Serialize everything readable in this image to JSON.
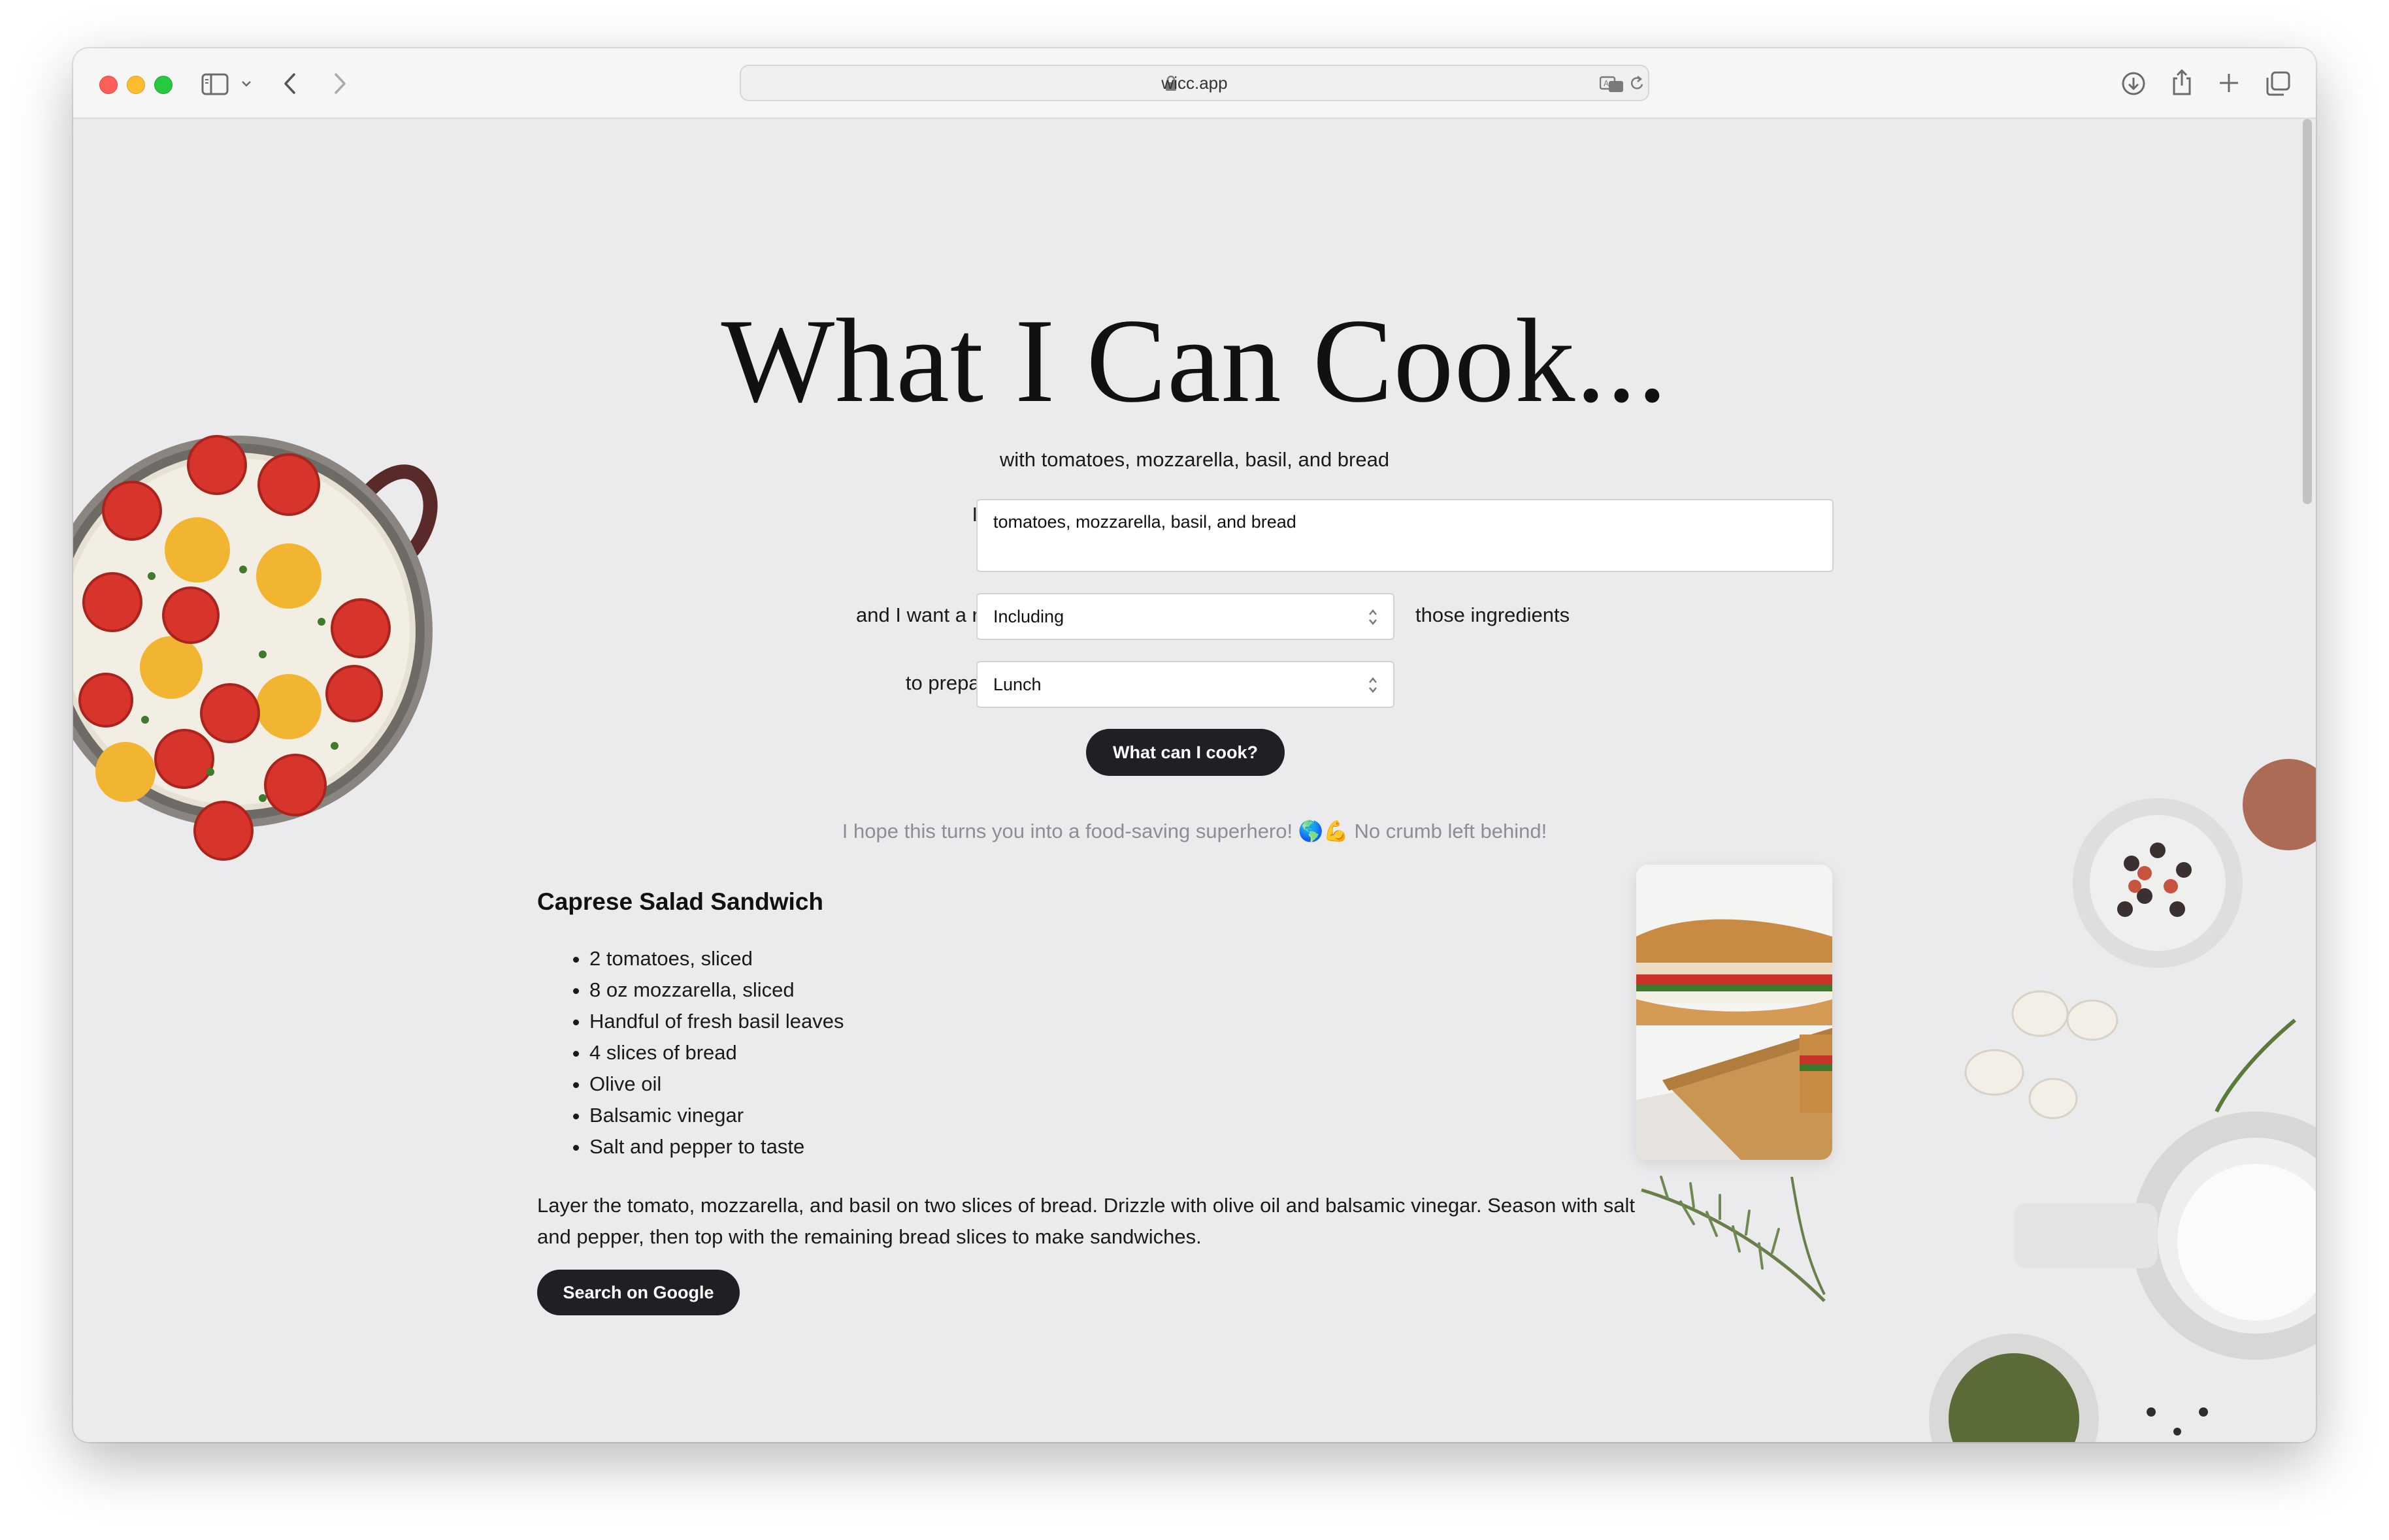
{
  "browser": {
    "url": "wicc.app"
  },
  "page": {
    "title": "What I Can Cook...",
    "subtitle": "with tomatoes, mozzarella, basil, and bread",
    "form": {
      "have_label": "I have",
      "ingredients_value": "tomatoes, mozzarella, basil, and bread",
      "recipe_label": "and I want a recipe",
      "mode_value": "Including",
      "mode_suffix": "those ingredients",
      "meal_label": "to prepare for",
      "meal_value": "Lunch",
      "submit_label": "What can I cook?"
    },
    "tagline": "I hope this turns you into a food-saving superhero! 🌎💪 No crumb left behind!",
    "recipe": {
      "title": "Caprese Salad Sandwich",
      "ingredients": [
        "2 tomatoes, sliced",
        "8 oz mozzarella, sliced",
        "Handful of fresh basil leaves",
        "4 slices of bread",
        "Olive oil",
        "Balsamic vinegar",
        "Salt and pepper to taste"
      ],
      "instructions": "Layer the tomato, mozzarella, and basil on two slices of bread. Drizzle with olive oil and balsamic vinegar. Season with salt and pepper, then top with the remaining bread slices to make sandwiches.",
      "google_label": "Search on Google"
    }
  },
  "icons": {
    "sidebar": "sidebar-icon",
    "back": "chevron-left-icon",
    "forward": "chevron-right-icon",
    "download": "download-icon",
    "share": "share-icon",
    "new_tab": "plus-icon",
    "tabs": "tabs-overview-icon"
  },
  "colors": {
    "page_background": "#ebebed",
    "button": "#1f2024",
    "tagline": "#8e8e92"
  }
}
